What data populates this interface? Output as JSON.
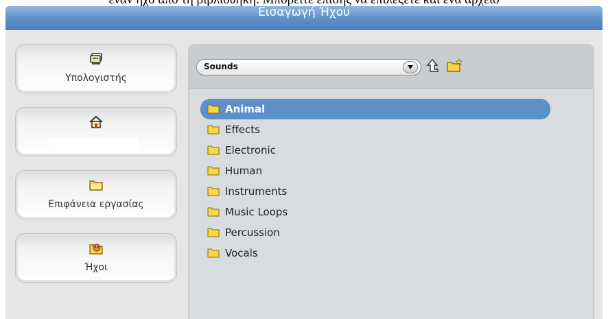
{
  "caption": "έναν ήχο από τη βιβλιοθήκη. Μπορείτε επίσης να επιλέξετε και ένα αρχείο",
  "window": {
    "title": "Εισαγωγή Ήχου"
  },
  "locations": [
    {
      "icon": "computer-icon",
      "label": "Υπολογιστής"
    },
    {
      "icon": "home-icon",
      "label": ""
    },
    {
      "icon": "folder-icon",
      "label": "Επιφάνεια εργασίας"
    },
    {
      "icon": "sounds-icon",
      "label": "Ήχοι"
    }
  ],
  "browser": {
    "current_folder": "Sounds",
    "tools": [
      "up-folder-icon",
      "new-folder-icon"
    ],
    "items": [
      {
        "name": "Animal",
        "selected": true
      },
      {
        "name": "Effects",
        "selected": false
      },
      {
        "name": "Electronic",
        "selected": false
      },
      {
        "name": "Human",
        "selected": false
      },
      {
        "name": "Instruments",
        "selected": false
      },
      {
        "name": "Music Loops",
        "selected": false
      },
      {
        "name": "Percussion",
        "selected": false
      },
      {
        "name": "Vocals",
        "selected": false
      }
    ]
  },
  "colors": {
    "title_bar": "#5d8fc8",
    "selection": "#5d8fc8",
    "folder": "#f7d64a"
  }
}
